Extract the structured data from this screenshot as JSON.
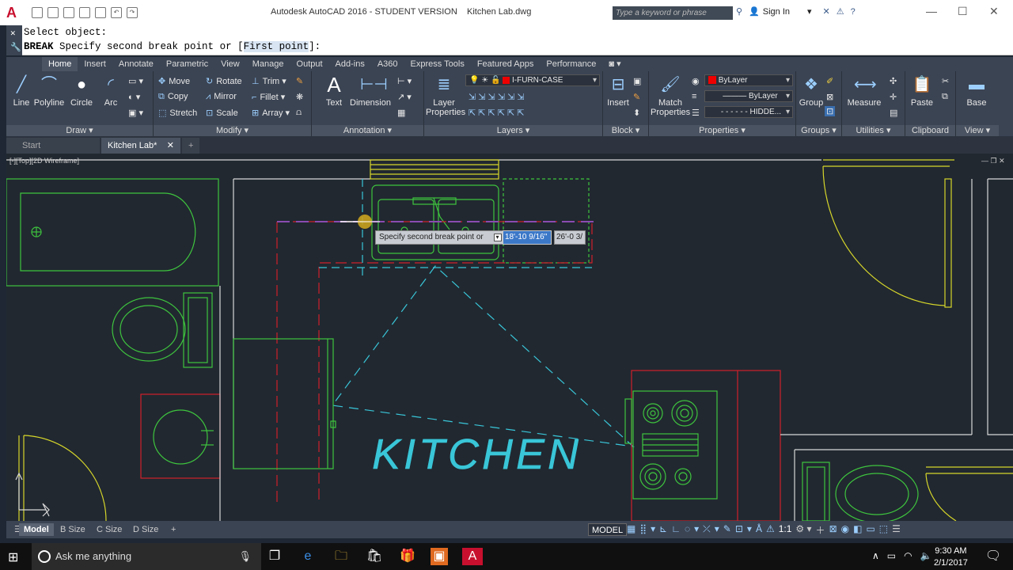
{
  "window": {
    "title": "Autodesk AutoCAD 2016 - STUDENT VERSION    Kitchen Lab.dwg",
    "search_placeholder": "Type a keyword or phrase",
    "sign_in": "Sign In"
  },
  "command": {
    "line1": "Select object:",
    "line2_cmd": "BREAK",
    "line2_text": "Specify second break point or [",
    "line2_option": "First point",
    "line2_end": "]:"
  },
  "ribbon_tabs": [
    "Home",
    "Insert",
    "Annotate",
    "Parametric",
    "View",
    "Manage",
    "Output",
    "Add-ins",
    "A360",
    "Express Tools",
    "Featured Apps",
    "Performance"
  ],
  "draw": {
    "label": "Draw ▾",
    "line": "Line",
    "polyline": "Polyline",
    "circle": "Circle",
    "arc": "Arc"
  },
  "modify": {
    "label": "Modify ▾",
    "move": "Move",
    "rotate": "Rotate",
    "trim": "Trim",
    "copy": "Copy",
    "mirror": "Mirror",
    "fillet": "Fillet",
    "stretch": "Stretch",
    "scale": "Scale",
    "array": "Array"
  },
  "annotation": {
    "label": "Annotation ▾",
    "text": "Text",
    "dimension": "Dimension"
  },
  "layers": {
    "label": "Layers ▾",
    "layer_properties_1": "Layer",
    "layer_properties_2": "Properties",
    "current_layer": "I-FURN-CASE"
  },
  "block": {
    "label": "Block ▾",
    "insert": "Insert"
  },
  "properties": {
    "label": "Properties ▾",
    "match_1": "Match",
    "match_2": "Properties",
    "color": "ByLayer",
    "lineweight": "ByLayer",
    "linetype": "HIDDE..."
  },
  "groups": {
    "label": "Groups ▾",
    "group": "Group"
  },
  "utilities": {
    "label": "Utilities ▾",
    "measure": "Measure"
  },
  "clipboard": {
    "label": "Clipboard",
    "paste": "Paste"
  },
  "view": {
    "label": "View ▾",
    "base": "Base"
  },
  "file_tabs": {
    "start": "Start",
    "current": "Kitchen Lab*"
  },
  "viewport_label": "[-][Top][2D Wireframe]",
  "tooltip": {
    "prompt": "Specify second break point or",
    "value1": "18'-10 9/16\"",
    "value2": "26'-0 3/"
  },
  "drawing_text": "KITCHEN",
  "layout_tabs": [
    "Model",
    "B Size",
    "C Size",
    "D Size"
  ],
  "status": {
    "model": "MODEL",
    "scale": "1:1"
  },
  "taskbar": {
    "search": "Ask me anything",
    "time": "9:30 AM",
    "date": "2/1/2017"
  },
  "colors": {
    "accent": "#c8102e",
    "cad_green": "#3ec43e",
    "cad_cyan": "#39c6d8",
    "cad_red": "#d0202a",
    "cad_yellow": "#d6d62a",
    "cad_purple": "#8a4bb0"
  }
}
